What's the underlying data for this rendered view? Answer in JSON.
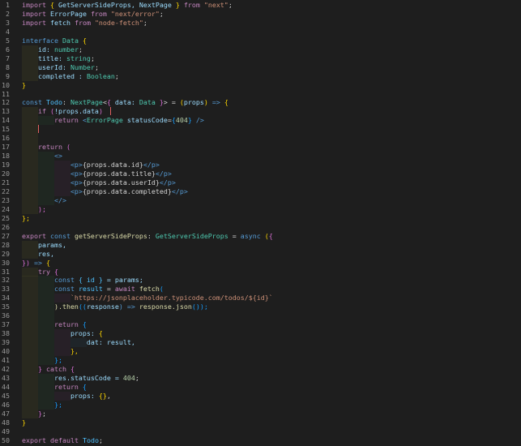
{
  "editor": {
    "lines": [
      {
        "n": "1",
        "indent": 0,
        "tokens": [
          [
            "import",
            "t-ctl"
          ],
          [
            " ",
            "t-plain"
          ],
          [
            "{",
            "t-brace1"
          ],
          [
            " GetServerSideProps, NextPage ",
            "t-var"
          ],
          [
            "}",
            "t-brace1"
          ],
          [
            " from ",
            "t-ctl"
          ],
          [
            "\"next\"",
            "t-str"
          ],
          [
            ";",
            "t-punct"
          ]
        ]
      },
      {
        "n": "2",
        "indent": 0,
        "tokens": [
          [
            "import",
            "t-ctl"
          ],
          [
            " ErrorPage ",
            "t-var"
          ],
          [
            "from ",
            "t-ctl"
          ],
          [
            "\"next/error\"",
            "t-str"
          ],
          [
            ";",
            "t-punct"
          ]
        ]
      },
      {
        "n": "3",
        "indent": 0,
        "tokens": [
          [
            "import",
            "t-ctl"
          ],
          [
            " fetch ",
            "t-var"
          ],
          [
            "from ",
            "t-ctl"
          ],
          [
            "\"node-fetch\"",
            "t-str"
          ],
          [
            ";",
            "t-punct"
          ]
        ]
      },
      {
        "n": "4",
        "indent": 0,
        "tokens": []
      },
      {
        "n": "5",
        "indent": 0,
        "tokens": [
          [
            "interface",
            "t-kw"
          ],
          [
            " ",
            "t-plain"
          ],
          [
            "Data",
            "t-type"
          ],
          [
            " {",
            "t-brace1"
          ]
        ]
      },
      {
        "n": "6",
        "indent": 1,
        "tokens": [
          [
            "    id: ",
            "t-var"
          ],
          [
            "number",
            "t-type"
          ],
          [
            ";",
            "t-punct"
          ]
        ]
      },
      {
        "n": "7",
        "indent": 1,
        "tokens": [
          [
            "    title: ",
            "t-var"
          ],
          [
            "string",
            "t-type"
          ],
          [
            ";",
            "t-punct"
          ]
        ]
      },
      {
        "n": "8",
        "indent": 1,
        "tokens": [
          [
            "    userId: ",
            "t-var"
          ],
          [
            "Number",
            "t-type"
          ],
          [
            ";",
            "t-punct"
          ]
        ]
      },
      {
        "n": "9",
        "indent": 1,
        "tokens": [
          [
            "    completed : ",
            "t-var"
          ],
          [
            "Boolean",
            "t-type"
          ],
          [
            ";",
            "t-punct"
          ]
        ]
      },
      {
        "n": "10",
        "indent": 0,
        "tokens": [
          [
            "}",
            "t-brace1"
          ]
        ]
      },
      {
        "n": "11",
        "indent": 0,
        "tokens": []
      },
      {
        "n": "12",
        "indent": 0,
        "tokens": [
          [
            "const",
            "t-kw"
          ],
          [
            " ",
            "t-plain"
          ],
          [
            "Todo",
            "t-const"
          ],
          [
            ": ",
            "t-punct"
          ],
          [
            "NextPage",
            "t-type"
          ],
          [
            "<",
            "t-punct"
          ],
          [
            "{",
            "t-brace2"
          ],
          [
            " data: ",
            "t-var"
          ],
          [
            "Data",
            "t-type"
          ],
          [
            " }",
            "t-brace2"
          ],
          [
            "> = ",
            "t-punct"
          ],
          [
            "(",
            "t-brace1"
          ],
          [
            "props",
            "t-var"
          ],
          [
            ")",
            "t-brace1"
          ],
          [
            " => ",
            "t-kw"
          ],
          [
            "{",
            "t-brace1"
          ]
        ]
      },
      {
        "n": "13",
        "indent": 1,
        "tokens": [
          [
            "    if",
            "t-ctl"
          ],
          [
            " (",
            "t-brace2"
          ],
          [
            "!props.data",
            "t-var"
          ],
          [
            ")",
            "t-brace2"
          ]
        ]
      },
      {
        "n": "14",
        "indent": 2,
        "tokens": [
          [
            "        return ",
            "t-ctl"
          ],
          [
            "<",
            "t-tag"
          ],
          [
            "ErrorPage",
            "t-type"
          ],
          [
            " statusCode",
            "t-attr"
          ],
          [
            "=",
            "t-punct"
          ],
          [
            "{",
            "t-brace3"
          ],
          [
            "404",
            "t-num"
          ],
          [
            "}",
            "t-brace3"
          ],
          [
            " />",
            "t-tag"
          ]
        ]
      },
      {
        "n": "15",
        "indent": 1,
        "tokens": []
      },
      {
        "n": "16",
        "indent": 1,
        "tokens": []
      },
      {
        "n": "17",
        "indent": 1,
        "tokens": [
          [
            "    return",
            "t-ctl"
          ],
          [
            " (",
            "t-brace2"
          ]
        ]
      },
      {
        "n": "18",
        "indent": 2,
        "tokens": [
          [
            "        <>",
            "t-tag"
          ]
        ]
      },
      {
        "n": "19",
        "indent": 3,
        "tokens": [
          [
            "            <p>",
            "t-tag"
          ],
          [
            "{props.data.id}",
            "t-tagtext"
          ],
          [
            "</p>",
            "t-tag"
          ]
        ]
      },
      {
        "n": "20",
        "indent": 3,
        "tokens": [
          [
            "            <p>",
            "t-tag"
          ],
          [
            "{props.data.title}",
            "t-tagtext"
          ],
          [
            "</p>",
            "t-tag"
          ]
        ]
      },
      {
        "n": "21",
        "indent": 3,
        "tokens": [
          [
            "            <p>",
            "t-tag"
          ],
          [
            "{props.data.userId}",
            "t-tagtext"
          ],
          [
            "</p>",
            "t-tag"
          ]
        ]
      },
      {
        "n": "22",
        "indent": 3,
        "tokens": [
          [
            "            <p>",
            "t-tag"
          ],
          [
            "{props.data.completed}",
            "t-tagtext"
          ],
          [
            "</p>",
            "t-tag"
          ]
        ]
      },
      {
        "n": "23",
        "indent": 2,
        "tokens": [
          [
            "        </>",
            "t-tag"
          ]
        ]
      },
      {
        "n": "24",
        "indent": 1,
        "tokens": [
          [
            "    );",
            "t-brace2"
          ]
        ]
      },
      {
        "n": "25",
        "indent": 0,
        "tokens": [
          [
            "};",
            "t-brace1"
          ]
        ]
      },
      {
        "n": "26",
        "indent": 0,
        "tokens": []
      },
      {
        "n": "27",
        "indent": 0,
        "tokens": [
          [
            "export",
            "t-ctl"
          ],
          [
            " const ",
            "t-kw"
          ],
          [
            "getServerSideProps",
            "t-fn"
          ],
          [
            ": ",
            "t-punct"
          ],
          [
            "GetServerSideProps",
            "t-type"
          ],
          [
            " = ",
            "t-punct"
          ],
          [
            "async",
            "t-kw"
          ],
          [
            " (",
            "t-brace1"
          ],
          [
            "{",
            "t-brace2"
          ]
        ]
      },
      {
        "n": "28",
        "indent": 1,
        "tokens": [
          [
            "    params,",
            "t-var"
          ]
        ]
      },
      {
        "n": "29",
        "indent": 1,
        "tokens": [
          [
            "    res,",
            "t-var"
          ]
        ]
      },
      {
        "n": "30",
        "indent": 0,
        "tokens": [
          [
            "})",
            "t-brace2"
          ],
          [
            " => ",
            "t-kw"
          ],
          [
            "{",
            "t-brace1"
          ]
        ]
      },
      {
        "n": "31",
        "indent": 1,
        "tokens": [
          [
            "    try",
            "t-ctl"
          ],
          [
            " {",
            "t-brace2"
          ]
        ]
      },
      {
        "n": "32",
        "indent": 2,
        "tokens": [
          [
            "        const",
            "t-kw"
          ],
          [
            " ",
            "t-plain"
          ],
          [
            "{ id }",
            "t-const"
          ],
          [
            " = params;",
            "t-var"
          ]
        ]
      },
      {
        "n": "33",
        "indent": 2,
        "tokens": [
          [
            "        const",
            "t-kw"
          ],
          [
            " ",
            "t-plain"
          ],
          [
            "result",
            "t-const"
          ],
          [
            " = ",
            "t-punct"
          ],
          [
            "await",
            "t-ctl"
          ],
          [
            " fetch",
            "t-fn"
          ],
          [
            "(",
            "t-brace3"
          ]
        ]
      },
      {
        "n": "34",
        "indent": 3,
        "tokens": [
          [
            "            `https://jsonplaceholder.typicode.com/todos/${id}`",
            "t-str"
          ]
        ]
      },
      {
        "n": "35",
        "indent": 2,
        "tokens": [
          [
            "        ).then",
            "t-fn"
          ],
          [
            "((",
            "t-brace3"
          ],
          [
            "response",
            "t-var"
          ],
          [
            ") => ",
            "t-kw"
          ],
          [
            "response.json",
            "t-fn"
          ],
          [
            "());",
            "t-brace3"
          ]
        ]
      },
      {
        "n": "36",
        "indent": 2,
        "tokens": []
      },
      {
        "n": "37",
        "indent": 2,
        "tokens": [
          [
            "        return",
            "t-ctl"
          ],
          [
            " {",
            "t-brace3"
          ]
        ]
      },
      {
        "n": "38",
        "indent": 3,
        "tokens": [
          [
            "            props: ",
            "t-var"
          ],
          [
            "{",
            "t-brace1"
          ]
        ]
      },
      {
        "n": "39",
        "indent": 4,
        "tokens": [
          [
            "                dat: result,",
            "t-var"
          ]
        ]
      },
      {
        "n": "40",
        "indent": 3,
        "tokens": [
          [
            "            },",
            "t-brace1"
          ]
        ]
      },
      {
        "n": "41",
        "indent": 2,
        "tokens": [
          [
            "        };",
            "t-brace3"
          ]
        ]
      },
      {
        "n": "42",
        "indent": 1,
        "tokens": [
          [
            "    }",
            "t-brace2"
          ],
          [
            " catch",
            "t-ctl"
          ],
          [
            " {",
            "t-brace2"
          ]
        ]
      },
      {
        "n": "43",
        "indent": 2,
        "tokens": [
          [
            "        res.statusCode = ",
            "t-var"
          ],
          [
            "404",
            "t-num"
          ],
          [
            ";",
            "t-punct"
          ]
        ]
      },
      {
        "n": "44",
        "indent": 2,
        "tokens": [
          [
            "        return",
            "t-ctl"
          ],
          [
            " {",
            "t-brace3"
          ]
        ]
      },
      {
        "n": "45",
        "indent": 3,
        "tokens": [
          [
            "            props: ",
            "t-var"
          ],
          [
            "{}",
            "t-brace1"
          ],
          [
            ",",
            "t-punct"
          ]
        ]
      },
      {
        "n": "46",
        "indent": 2,
        "tokens": [
          [
            "        };",
            "t-brace3"
          ]
        ]
      },
      {
        "n": "47",
        "indent": 1,
        "tokens": [
          [
            "    }",
            "t-brace2"
          ],
          [
            ";",
            "t-punct"
          ]
        ]
      },
      {
        "n": "48",
        "indent": 0,
        "tokens": [
          [
            "}",
            "t-brace1"
          ]
        ]
      },
      {
        "n": "49",
        "indent": 0,
        "tokens": []
      },
      {
        "n": "50",
        "indent": 0,
        "tokens": [
          [
            "export",
            "t-ctl"
          ],
          [
            " default ",
            "t-ctl"
          ],
          [
            "Todo",
            "t-const"
          ],
          [
            ";",
            "t-punct"
          ]
        ]
      }
    ],
    "colors": {
      "background": "#1e1e1e",
      "line_number": "#9a9a9a"
    }
  }
}
